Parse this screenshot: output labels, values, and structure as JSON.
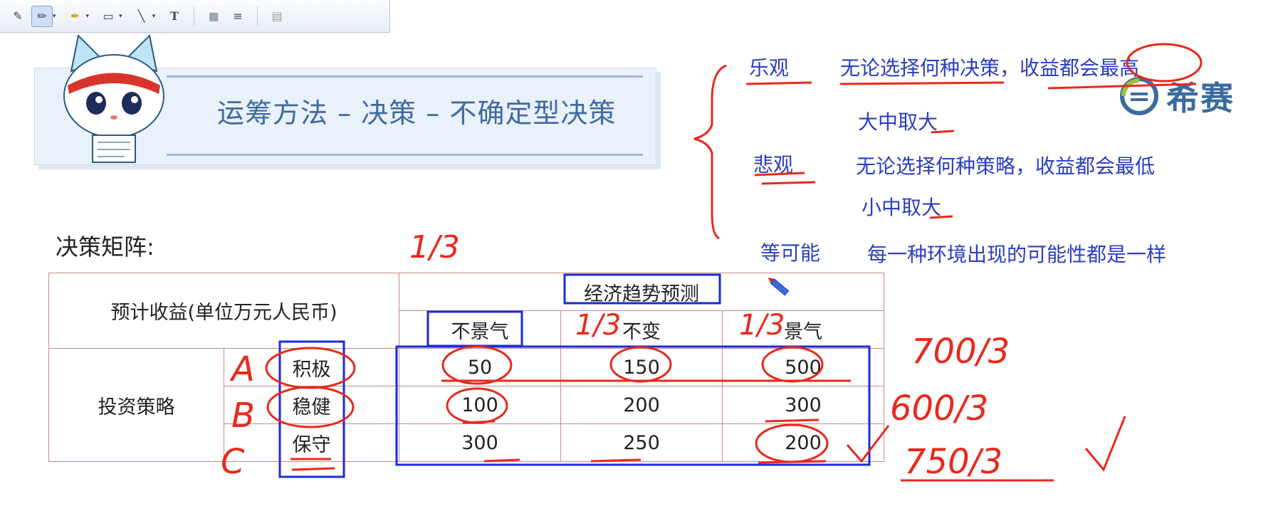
{
  "toolbar": {
    "tools": [
      {
        "name": "note-tool",
        "glyph": "✎"
      },
      {
        "name": "pen-tool",
        "glyph": "✏"
      },
      {
        "name": "highlighter-tool",
        "glyph": "🖍"
      },
      {
        "name": "rectangle-tool",
        "glyph": "□"
      },
      {
        "name": "line-tool",
        "glyph": "╲"
      },
      {
        "name": "text-tool",
        "glyph": "T"
      },
      {
        "name": "fill-tool",
        "glyph": "■"
      },
      {
        "name": "line-width-tool",
        "glyph": "≡"
      },
      {
        "name": "clear-tool",
        "glyph": "▤"
      }
    ]
  },
  "slide": {
    "title": "运筹方法 – 决策 – 不确定型决策",
    "logo_text": "希赛",
    "section_label": "决策矩阵:"
  },
  "annotations": {
    "optimistic": {
      "label": "乐观",
      "desc": "无论选择何种决策，收益都会最高",
      "rule": "大中取大"
    },
    "pessimistic": {
      "label": "悲观",
      "desc": "无论选择何种策略，收益都会最低",
      "rule": "小中取大"
    },
    "equal": {
      "label": "等可能",
      "desc": "每一种环境出现的可能性都是一样"
    }
  },
  "matrix": {
    "corner_label": "预计收益(单位万元人民币)",
    "group_header": "经济趋势预测",
    "row_group": "投资策略",
    "columns": [
      "不景气",
      "不变",
      "景气"
    ],
    "rows": [
      {
        "name": "积极",
        "values": [
          "50",
          "150",
          "500"
        ]
      },
      {
        "name": "稳健",
        "values": [
          "100",
          "200",
          "300"
        ]
      },
      {
        "name": "保守",
        "values": [
          "300",
          "250",
          "200"
        ]
      }
    ]
  },
  "handwriting": {
    "prob_main": "1/3",
    "prob_col2": "1/3",
    "prob_col3": "1/3",
    "row_letters": [
      "A",
      "B",
      "C"
    ],
    "results": [
      "700/3",
      "600/3",
      "750/3"
    ]
  },
  "colors": {
    "ink_red": "#e8291c",
    "ink_blue": "#1a2bd6",
    "title_blue": "#3f6aa0"
  }
}
